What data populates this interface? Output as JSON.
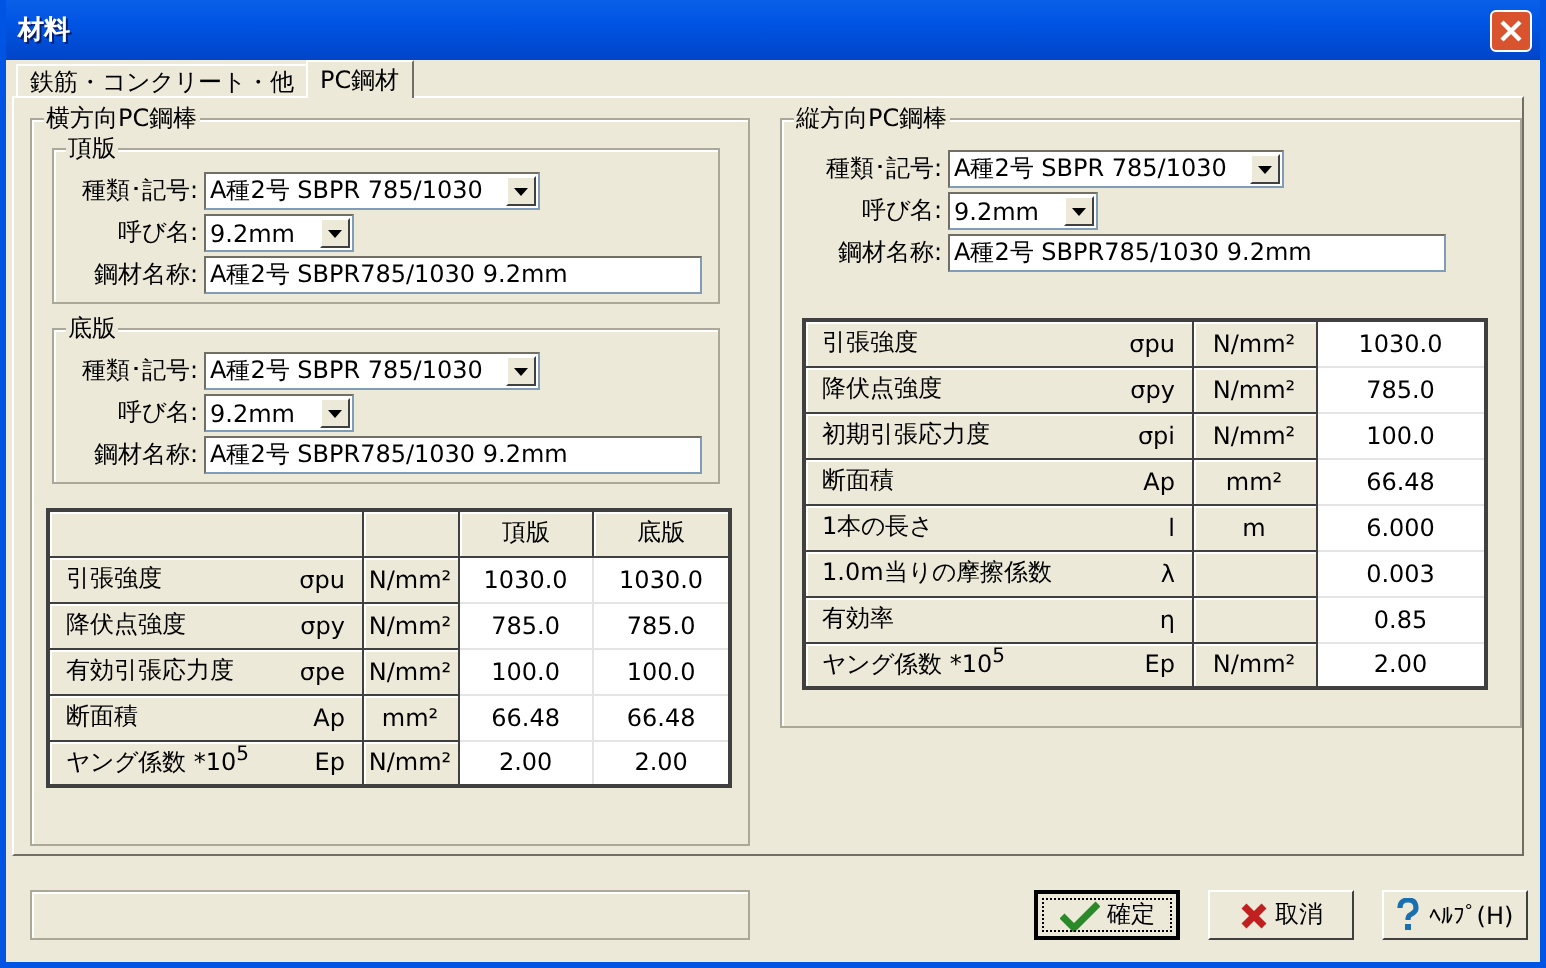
{
  "window": {
    "title": "材料"
  },
  "tabs": [
    {
      "label": "鉄筋・コンクリート・他",
      "selected": false
    },
    {
      "label": "PC鋼材",
      "selected": true
    }
  ],
  "left_group": {
    "title": "横方向PC鋼棒",
    "subgroups": [
      {
        "title": "頂版",
        "fields": [
          {
            "label": "種類･記号:",
            "value": "A種2号 SBPR 785/1030",
            "kind": "combo-wide"
          },
          {
            "label": "呼び名:",
            "value": "9.2mm",
            "kind": "combo-narrow"
          },
          {
            "label": "鋼材名称:",
            "value": "A種2号 SBPR785/1030 9.2mm",
            "kind": "text"
          }
        ]
      },
      {
        "title": "底版",
        "fields": [
          {
            "label": "種類･記号:",
            "value": "A種2号 SBPR 785/1030",
            "kind": "combo-wide"
          },
          {
            "label": "呼び名:",
            "value": "9.2mm",
            "kind": "combo-narrow"
          },
          {
            "label": "鋼材名称:",
            "value": "A種2号 SBPR785/1030 9.2mm",
            "kind": "text"
          }
        ]
      }
    ],
    "table": {
      "columns": [
        "頂版",
        "底版"
      ],
      "rows": [
        {
          "name": "引張強度",
          "symbol": "σpu",
          "unit": "N/mm²",
          "values": [
            "1030.0",
            "1030.0"
          ]
        },
        {
          "name": "降伏点強度",
          "symbol": "σpy",
          "unit": "N/mm²",
          "values": [
            "785.0",
            "785.0"
          ]
        },
        {
          "name": "有効引張応力度",
          "symbol": "σpe",
          "unit": "N/mm²",
          "values": [
            "100.0",
            "100.0"
          ]
        },
        {
          "name": "断面積",
          "symbol": "Ap",
          "unit": "mm²",
          "values": [
            "66.48",
            "66.48"
          ]
        },
        {
          "name": "ヤング係数 *10$^{5}$",
          "symbol": "Ep",
          "unit": "N/mm²",
          "values": [
            "2.00",
            "2.00"
          ]
        }
      ]
    }
  },
  "right_group": {
    "title": "縦方向PC鋼棒",
    "fields": [
      {
        "label": "種類･記号:",
        "value": "A種2号 SBPR 785/1030",
        "kind": "combo-wide"
      },
      {
        "label": "呼び名:",
        "value": "9.2mm",
        "kind": "combo-narrow"
      },
      {
        "label": "鋼材名称:",
        "value": "A種2号 SBPR785/1030 9.2mm",
        "kind": "text"
      }
    ],
    "table": {
      "rows": [
        {
          "name": "引張強度",
          "symbol": "σpu",
          "unit": "N/mm²",
          "values": [
            "1030.0"
          ]
        },
        {
          "name": "降伏点強度",
          "symbol": "σpy",
          "unit": "N/mm²",
          "values": [
            "785.0"
          ]
        },
        {
          "name": "初期引張応力度",
          "symbol": "σpi",
          "unit": "N/mm²",
          "values": [
            "100.0"
          ]
        },
        {
          "name": "断面積",
          "symbol": "Ap",
          "unit": "mm²",
          "values": [
            "66.48"
          ]
        },
        {
          "name": "1本の長さ",
          "symbol": "l",
          "unit": "m",
          "values": [
            "6.000"
          ]
        },
        {
          "name": "1.0m当りの摩擦係数",
          "symbol": "λ",
          "values": [
            "0.003"
          ]
        },
        {
          "name": "有効率",
          "symbol": "η",
          "values": [
            "0.85"
          ]
        },
        {
          "name": "ヤング係数 *10$^{5}$",
          "symbol": "Ep",
          "unit": "N/mm²",
          "values": [
            "2.00"
          ]
        }
      ]
    }
  },
  "buttons": [
    {
      "label": "確定",
      "kind": "check",
      "default": true
    },
    {
      "label": "取消",
      "kind": "cross",
      "default": false
    },
    {
      "label": "ﾍﾙﾌﾟ(H)",
      "kind": "help",
      "default": false
    }
  ]
}
